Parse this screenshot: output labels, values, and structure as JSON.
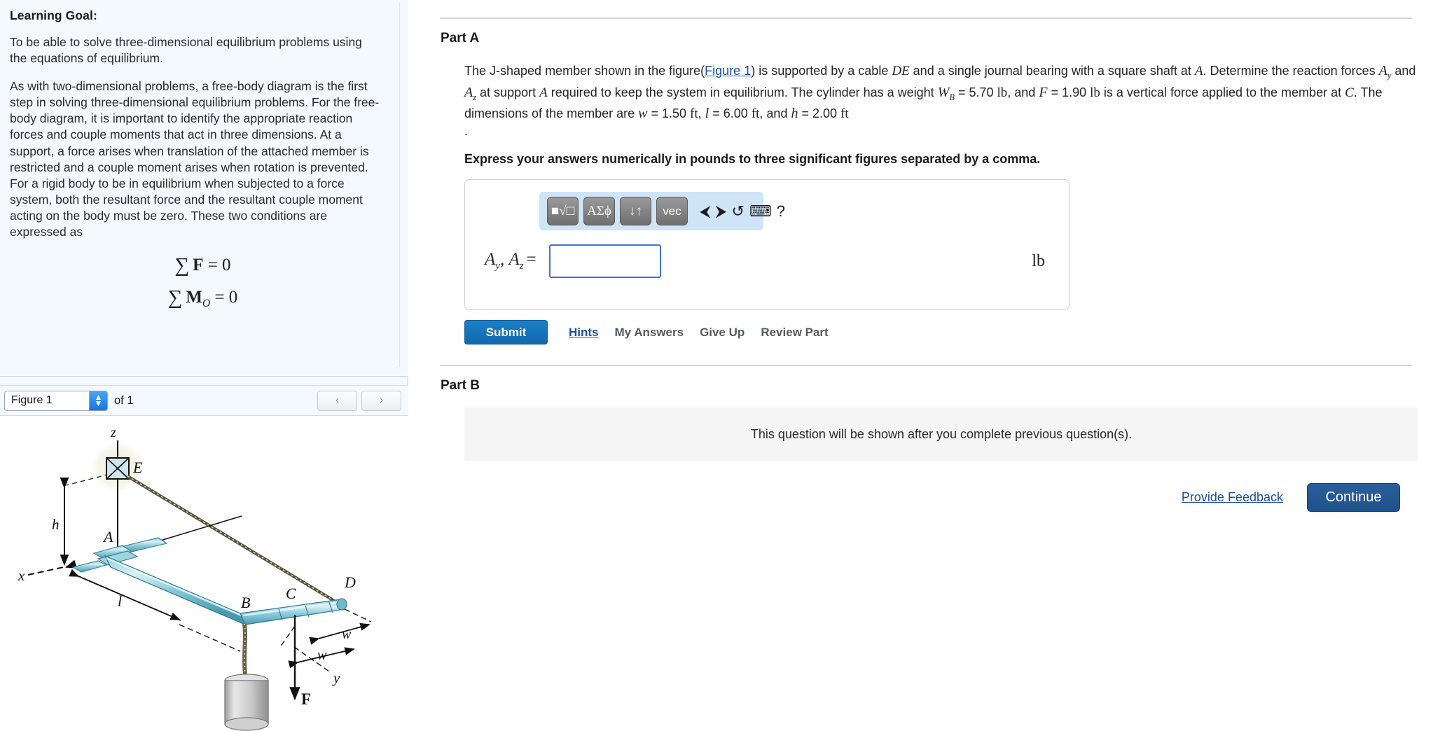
{
  "left": {
    "goal_title": "Learning Goal:",
    "para1": "To be able to solve three-dimensional equilibrium problems using the equations of equilibrium.",
    "para2": "As with two-dimensional problems, a free-body diagram is the first step in solving three-dimensional equilibrium problems. For the free-body diagram, it is important to identify the appropriate reaction forces and couple moments that act in three dimensions. At a support, a force arises when translation of the attached member is restricted and a couple moment arises when rotation is prevented.",
    "para3": "For a rigid body to be in equilibrium when subjected to a force system, both the resultant force and the resultant couple moment acting on the body must be zero. These two conditions are expressed as",
    "equation_force": "∑ F = 0",
    "equation_moment": "∑ M_O = 0",
    "figure_bar": {
      "selected": "Figure 1",
      "of_label": "of 1",
      "prev_label": "‹",
      "next_label": "›",
      "options": [
        "Figure 1"
      ]
    },
    "figure": {
      "labels": {
        "z": "z",
        "x": "x",
        "y": "y",
        "h": "h",
        "l": "l",
        "w1": "w",
        "w2": "w",
        "A": "A",
        "B": "B",
        "C": "C",
        "D": "D",
        "E": "E",
        "F": "F"
      }
    }
  },
  "right": {
    "part_a": {
      "title": "Part A",
      "q_pre": "The J-shaped member shown in the figure(",
      "q_link": "Figure 1",
      "q_mid1": ") is supported by a cable ",
      "q_cable": "DE",
      "q_mid2": " and a single journal bearing with a square shaft at ",
      "q_pointA": "A",
      "q_mid3": ". Determine the reaction forces ",
      "q_Ay": "A",
      "q_Ay_sub": "y",
      "q_mid4": " and ",
      "q_Az": "A",
      "q_Az_sub": "z",
      "q_mid5": " at support ",
      "q_pointA2": "A",
      "q_mid6": " required to keep the system in equilibrium. The cylinder has a weight ",
      "q_W": "W",
      "q_W_sub": "B",
      "q_W_eq": " = ",
      "q_W_val": "5.70",
      "q_W_unit": "lb",
      "q_mid7": ", and ",
      "q_F": "F",
      "q_F_eq": " = ",
      "q_F_val": "1.90",
      "q_F_unit": "lb",
      "q_mid8": " is a vertical force applied to the member at ",
      "q_pointC": "C",
      "q_mid9": ". The dimensions of the member are ",
      "q_w": "w",
      "q_w_eq": " = ",
      "q_w_val": "1.50",
      "q_w_unit": "ft",
      "q_mid10": ", ",
      "q_l": "l",
      "q_l_eq": " = ",
      "q_l_val": "6.00",
      "q_l_unit": "ft",
      "q_mid11": ", and ",
      "q_h": "h",
      "q_h_eq": " = ",
      "q_h_val": "2.00",
      "q_h_unit": "ft",
      "q_trailing_dot": ".",
      "express": "Express your answers numerically in pounds to three significant figures separated by a comma.",
      "toolbar": {
        "template_btn": "■√□",
        "greek_btn": "ΑΣϕ",
        "arrows_btn": "↓↑",
        "vec_btn": "vec",
        "undo_icon": "⮜",
        "redo_icon": "⮞",
        "reset_icon": "↺",
        "keyboard_icon": "⌨",
        "help_icon": "?"
      },
      "answer": {
        "label_a": "A",
        "label_a_sub": "y",
        "label_b": "A",
        "label_b_sub": "z",
        "equals": "=",
        "value": "",
        "placeholder": "",
        "unit": "lb"
      },
      "buttons": {
        "submit": "Submit",
        "hints": "Hints",
        "my_answers": "My Answers",
        "give_up": "Give Up",
        "review_part": "Review Part"
      }
    },
    "part_b": {
      "title": "Part B",
      "locked_message": "This question will be shown after you complete previous question(s)."
    },
    "footer": {
      "feedback": "Provide Feedback",
      "continue": "Continue"
    }
  },
  "colors": {
    "link_blue": "#1a4fa3",
    "submit_blue": "#1268ad",
    "continue_blue": "#1f5289",
    "toolbar_bg": "#cfe4f7",
    "panel_bg": "#f4f9fd",
    "input_border": "#3b74d6"
  }
}
